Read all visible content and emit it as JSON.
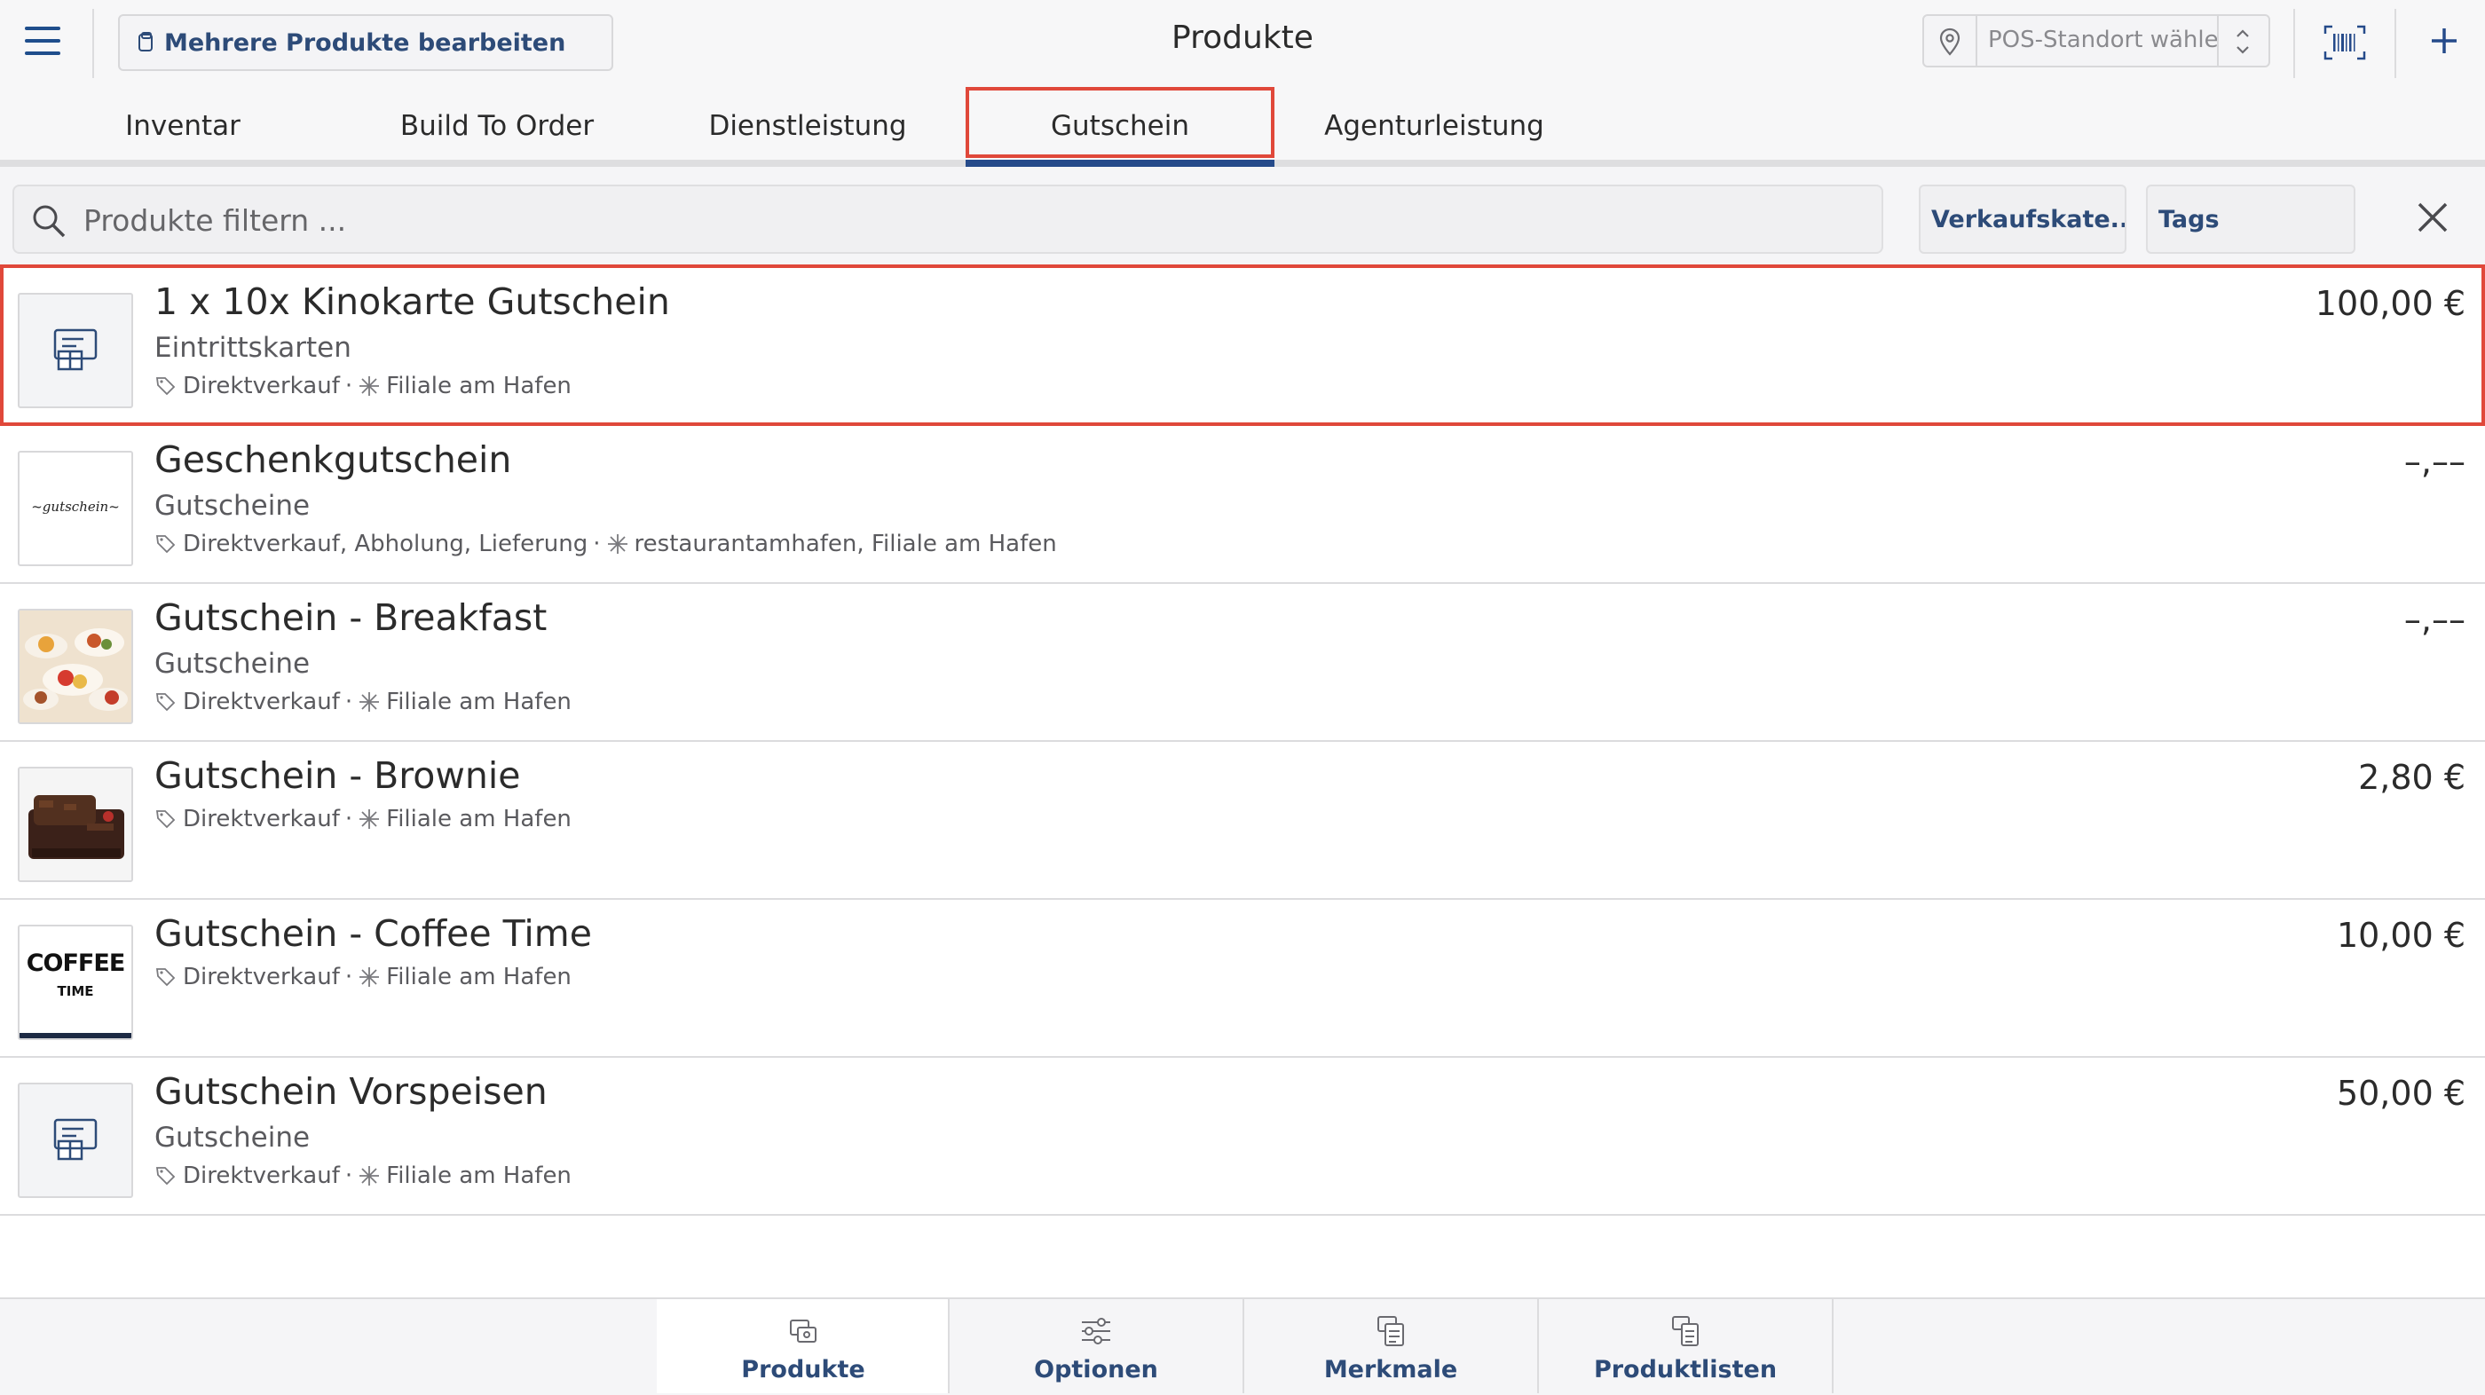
{
  "header": {
    "multi_edit_label": "Mehrere Produkte bearbeiten",
    "title": "Produkte",
    "location_placeholder": "POS-Standort wählen..."
  },
  "tabs": [
    {
      "label": "Inventar"
    },
    {
      "label": "Build To Order"
    },
    {
      "label": "Dienstleistung"
    },
    {
      "label": "Gutschein",
      "active": true
    },
    {
      "label": "Agenturleistung"
    }
  ],
  "filter": {
    "search_placeholder": "Produkte filtern ...",
    "sales_category_label": "Verkaufskate...",
    "tags_label": "Tags"
  },
  "products": [
    {
      "name": "1 x 10x Kinokarte Gutschein",
      "category": "Eintrittskarten",
      "channels": "Direktverkauf",
      "locations": "Filiale am Hafen",
      "price": "100,00 €",
      "thumb": "voucher-placeholder-icon",
      "highlighted": true
    },
    {
      "name": "Geschenkgutschein",
      "category": "Gutscheine",
      "channels": "Direktverkauf, Abholung, Lieferung",
      "locations": "restaurantamhafen, Filiale am Hafen",
      "price": "–,––",
      "thumb": "gutschein-script-image",
      "thumb_text": "~gutschein~"
    },
    {
      "name": "Gutschein - Breakfast",
      "category": "Gutscheine",
      "channels": "Direktverkauf",
      "locations": "Filiale am Hafen",
      "price": "–,––",
      "thumb": "breakfast-photo"
    },
    {
      "name": "Gutschein - Brownie",
      "category": "",
      "channels": "Direktverkauf",
      "locations": "Filiale am Hafen",
      "price": "2,80 €",
      "thumb": "brownie-photo"
    },
    {
      "name": "Gutschein - Coffee Time",
      "category": "",
      "channels": "Direktverkauf",
      "locations": "Filiale am Hafen",
      "price": "10,00 €",
      "thumb": "coffee-time-logo",
      "thumb_text_1": "COFFEE",
      "thumb_text_2": "TIME"
    },
    {
      "name": "Gutschein Vorspeisen",
      "category": "Gutscheine",
      "channels": "Direktverkauf",
      "locations": "Filiale am Hafen",
      "price": "50,00 €",
      "thumb": "voucher-placeholder-icon"
    }
  ],
  "bottom_nav": [
    {
      "label": "Produkte",
      "icon": "products-icon",
      "active": true
    },
    {
      "label": "Optionen",
      "icon": "sliders-icon"
    },
    {
      "label": "Merkmale",
      "icon": "attributes-icon"
    },
    {
      "label": "Produktlisten",
      "icon": "product-lists-icon"
    }
  ],
  "colors": {
    "accent": "#254a8a",
    "highlight": "#e0483a",
    "label_blue": "#2d4b78"
  }
}
